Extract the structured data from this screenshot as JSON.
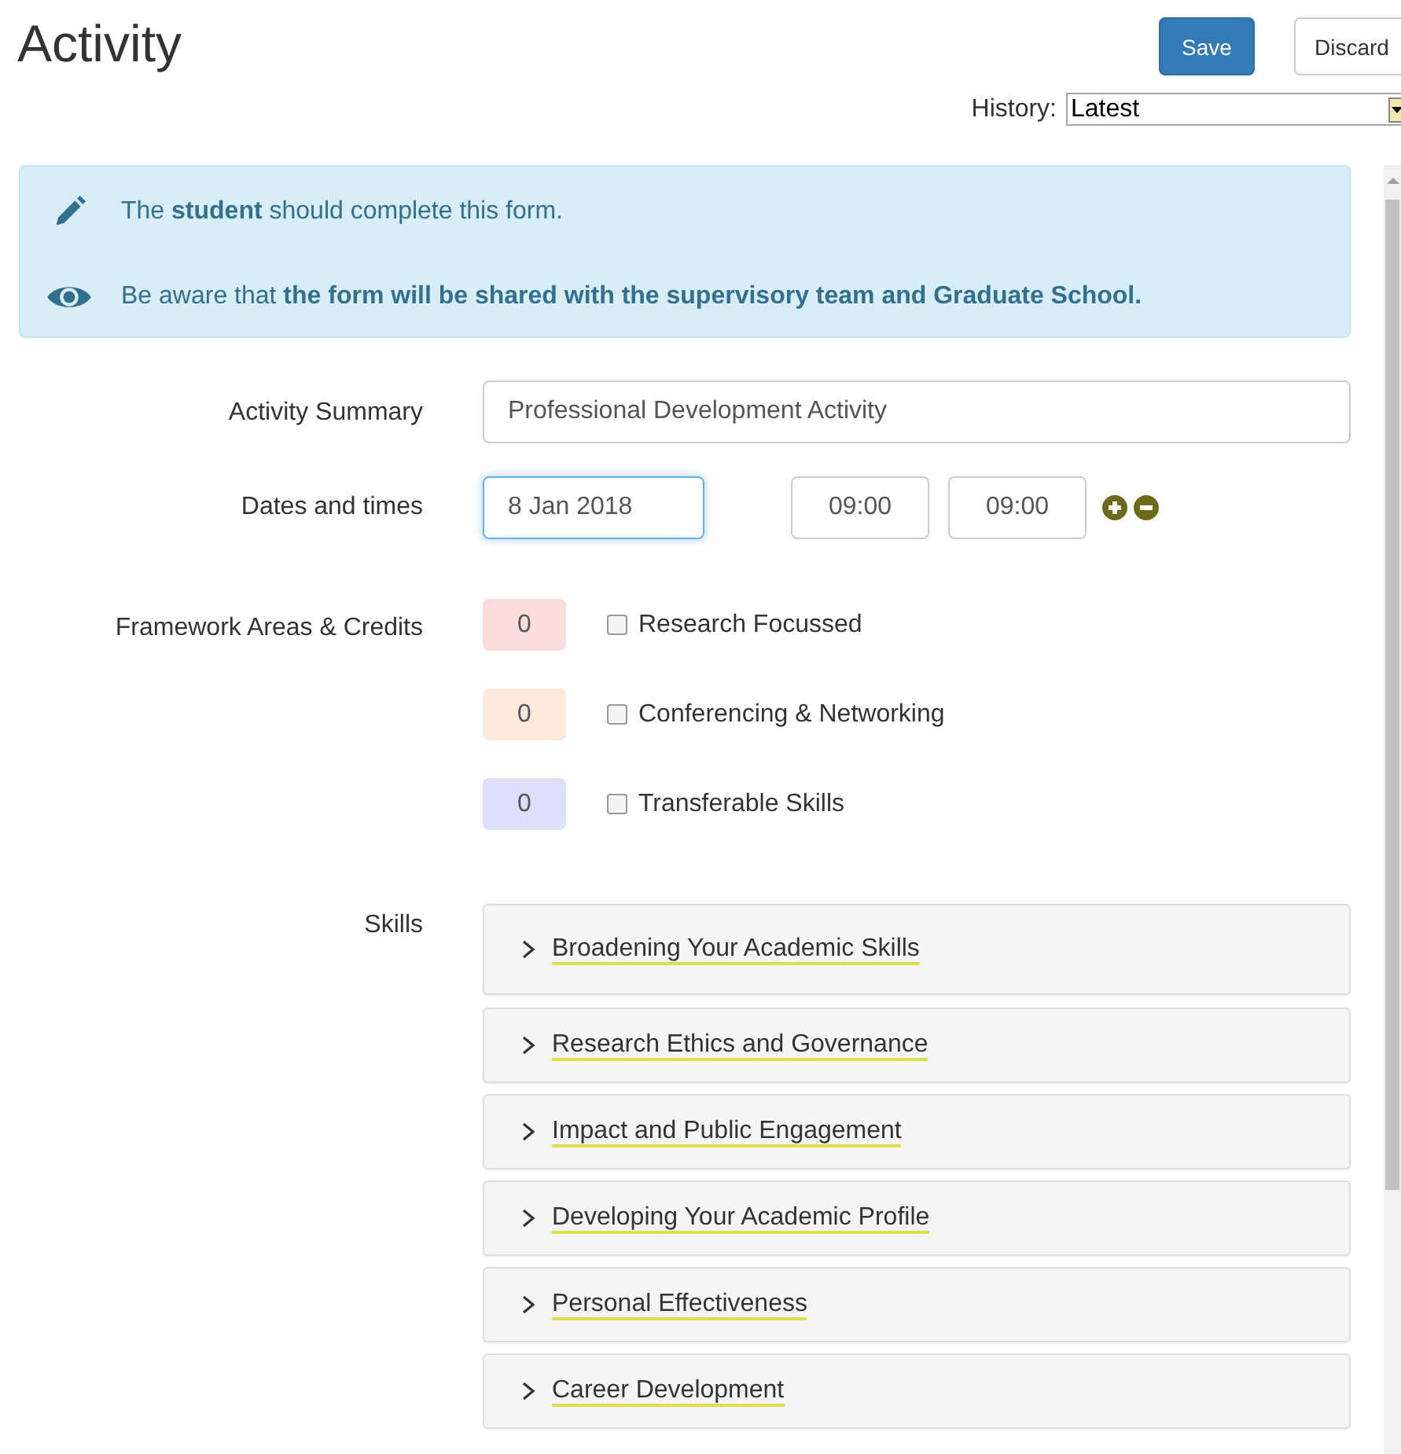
{
  "title": "Activity",
  "actions": [
    {
      "label": "Save",
      "kind": "primary"
    },
    {
      "label": "Discard",
      "kind": "default"
    }
  ],
  "history": {
    "label": "History:",
    "value": "Latest"
  },
  "notices": [
    {
      "kind": "edit",
      "text": "The **student** should complete this form."
    },
    {
      "kind": "view",
      "text": "Be aware that **the form will be shared with the supervisory team and Graduate School.**"
    }
  ],
  "summary": {
    "label": "Activity Summary",
    "value": "Professional Development Activity"
  },
  "dates": {
    "label": "Dates and times",
    "date": "8 Jan 2018",
    "start": "09:00",
    "end": "09:00",
    "focused": true
  },
  "framework": {
    "label": "Framework Areas & Credits",
    "areas": [
      {
        "credits": "0",
        "label": "Research Focussed",
        "checked": false,
        "color": "#fddcdc"
      },
      {
        "credits": "0",
        "label": "Conferencing & Networking",
        "checked": false,
        "color": "#fde9dc"
      },
      {
        "credits": "0",
        "label": "Transferable Skills",
        "checked": false,
        "color": "#dfdffd"
      }
    ]
  },
  "skills": {
    "label": "Skills",
    "sections": [
      {
        "title": "Broadening Your Academic Skills",
        "expanded": false
      },
      {
        "title": "Research Ethics and Governance",
        "expanded": false
      },
      {
        "title": "Impact and Public Engagement",
        "expanded": false
      },
      {
        "title": "Developing Your Academic Profile",
        "expanded": false
      },
      {
        "title": "Personal Effectiveness",
        "expanded": false
      },
      {
        "title": "Career Development",
        "expanded": false
      }
    ]
  }
}
